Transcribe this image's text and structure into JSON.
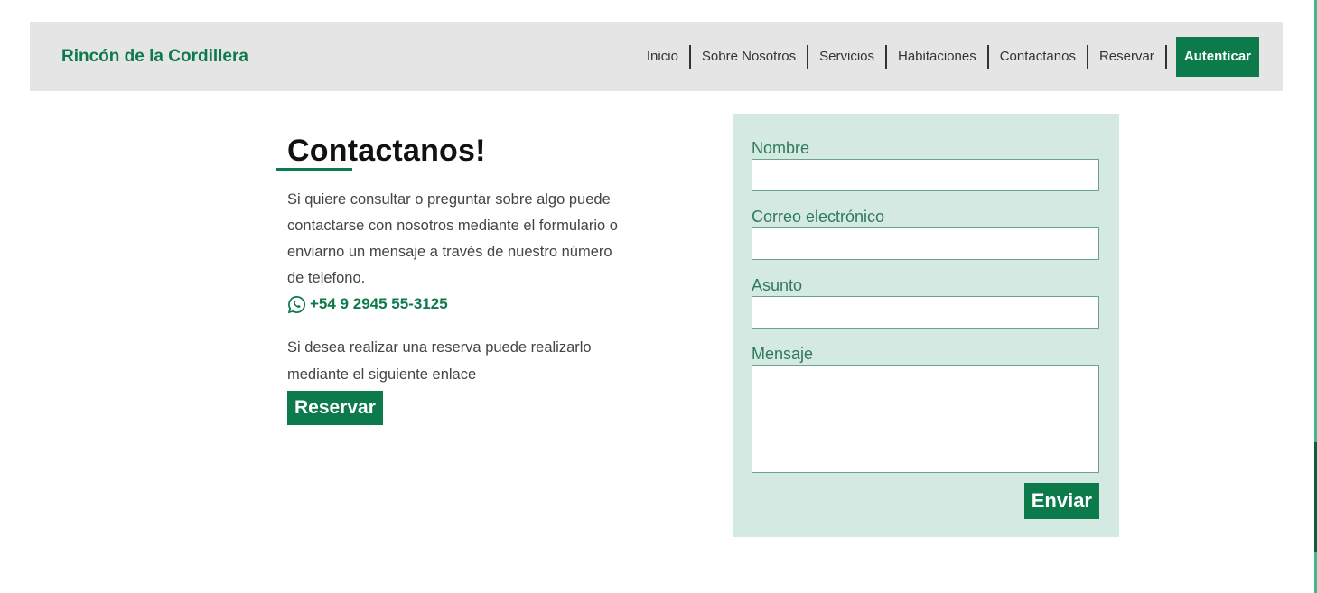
{
  "navbar": {
    "brand": "Rincón de la Cordillera",
    "links": [
      "Inicio",
      "Sobre Nosotros",
      "Servicios",
      "Habitaciones",
      "Contactanos",
      "Reservar"
    ],
    "cta": "Autenticar"
  },
  "contact": {
    "heading": "Contactanos!",
    "paragraph": "Si quiere consultar o preguntar sobre algo puede contactarse con nosotros mediante el formulario o enviarno un mensaje a través de nuestro número de telefono.",
    "phone": "+54 9 2945 55-3125",
    "reserve_text": "Si desea realizar una reserva puede realizarlo mediante el siguiente enlace",
    "reserve_button": "Reservar"
  },
  "form": {
    "name_label": "Nombre",
    "email_label": "Correo electrónico",
    "subject_label": "Asunto",
    "message_label": "Mensaje",
    "submit": "Enviar"
  },
  "colors": {
    "accent": "#0d7a4c",
    "form_bg": "#d3e9e1",
    "navbar_bg": "#e5e5e5"
  },
  "icons": {
    "phone": "whatsapp-icon"
  }
}
